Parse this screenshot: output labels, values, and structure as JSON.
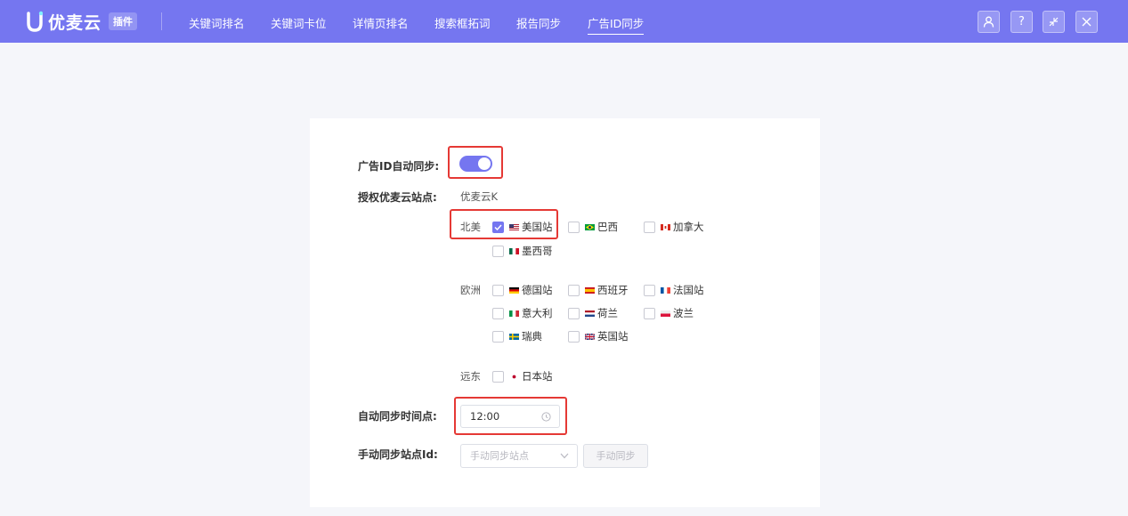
{
  "header": {
    "logo_text": "优麦云",
    "logo_badge": "插件",
    "nav": [
      {
        "label": "关键词排名"
      },
      {
        "label": "关键词卡位"
      },
      {
        "label": "详情页排名"
      },
      {
        "label": "搜索框拓词"
      },
      {
        "label": "报告同步"
      },
      {
        "label": "广告ID同步"
      }
    ],
    "active_nav": "广告ID同步",
    "buttons": {
      "user": "user-icon",
      "help": "?",
      "collapse": "collapse-icon",
      "close": "close-icon"
    }
  },
  "form": {
    "auto_sync_label": "广告ID自动同步:",
    "auto_sync_enabled": true,
    "auth_sites_label": "授权优麦云站点:",
    "auth_account": "优麦云K",
    "regions": {
      "north_america": {
        "label": "北美",
        "sites": [
          {
            "name": "美国站",
            "checked": true
          },
          {
            "name": "巴西",
            "checked": false
          },
          {
            "name": "加拿大",
            "checked": false
          },
          {
            "name": "墨西哥",
            "checked": false
          }
        ]
      },
      "europe": {
        "label": "欧洲",
        "sites": [
          {
            "name": "德国站",
            "checked": false
          },
          {
            "name": "西班牙",
            "checked": false
          },
          {
            "name": "法国站",
            "checked": false
          },
          {
            "name": "意大利",
            "checked": false
          },
          {
            "name": "荷兰",
            "checked": false
          },
          {
            "name": "波兰",
            "checked": false
          },
          {
            "name": "瑞典",
            "checked": false
          },
          {
            "name": "英国站",
            "checked": false
          }
        ]
      },
      "far_east": {
        "label": "远东",
        "sites": [
          {
            "name": "日本站",
            "checked": false
          }
        ]
      }
    },
    "sync_time_label": "自动同步时间点:",
    "sync_time_value": "12:00",
    "manual_sync_label": "手动同步站点Id:",
    "manual_sync_placeholder": "手动同步站点",
    "manual_sync_button": "手动同步"
  },
  "colors": {
    "accent": "#7576f0",
    "highlight": "#e53935"
  }
}
